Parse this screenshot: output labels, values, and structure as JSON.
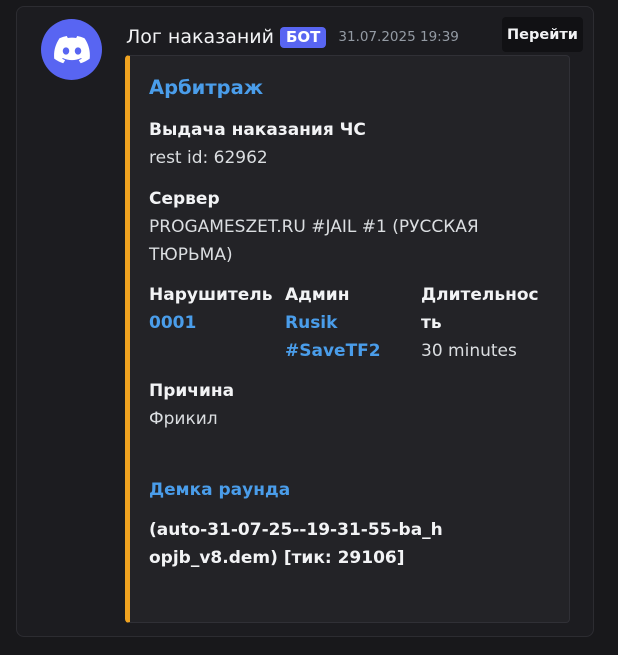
{
  "message": {
    "username": "Лог наказаний",
    "badge": "БОТ",
    "timestamp": "31.07.2025 19:39",
    "goto_label": "Перейти"
  },
  "embed": {
    "accent_color": "#f0a320",
    "title": "Арбитраж",
    "description_heading": "Выдача наказания ЧС",
    "description_line": "rest id: 62962",
    "server": {
      "name": "Сервер",
      "value": "PROGAMESZET.RU #JAIL #1 (РУССКАЯ ТЮРЬМА)"
    },
    "offender": {
      "name": "Нарушитель",
      "value": "0001"
    },
    "admin": {
      "name": "Админ",
      "value": "Rusik #SaveTF2"
    },
    "duration": {
      "name": "Длительность",
      "value": "30 minutes"
    },
    "reason": {
      "name": "Причина",
      "value": "Фрикил"
    },
    "demo": {
      "title": "Демка раунда",
      "value": "(auto-31-07-25--19-31-55-ba_hopjb_v8.dem) [тик: 29106]"
    }
  },
  "colors": {
    "brand": "#5865f2",
    "link": "#4a9dea",
    "accent": "#f0a320"
  }
}
